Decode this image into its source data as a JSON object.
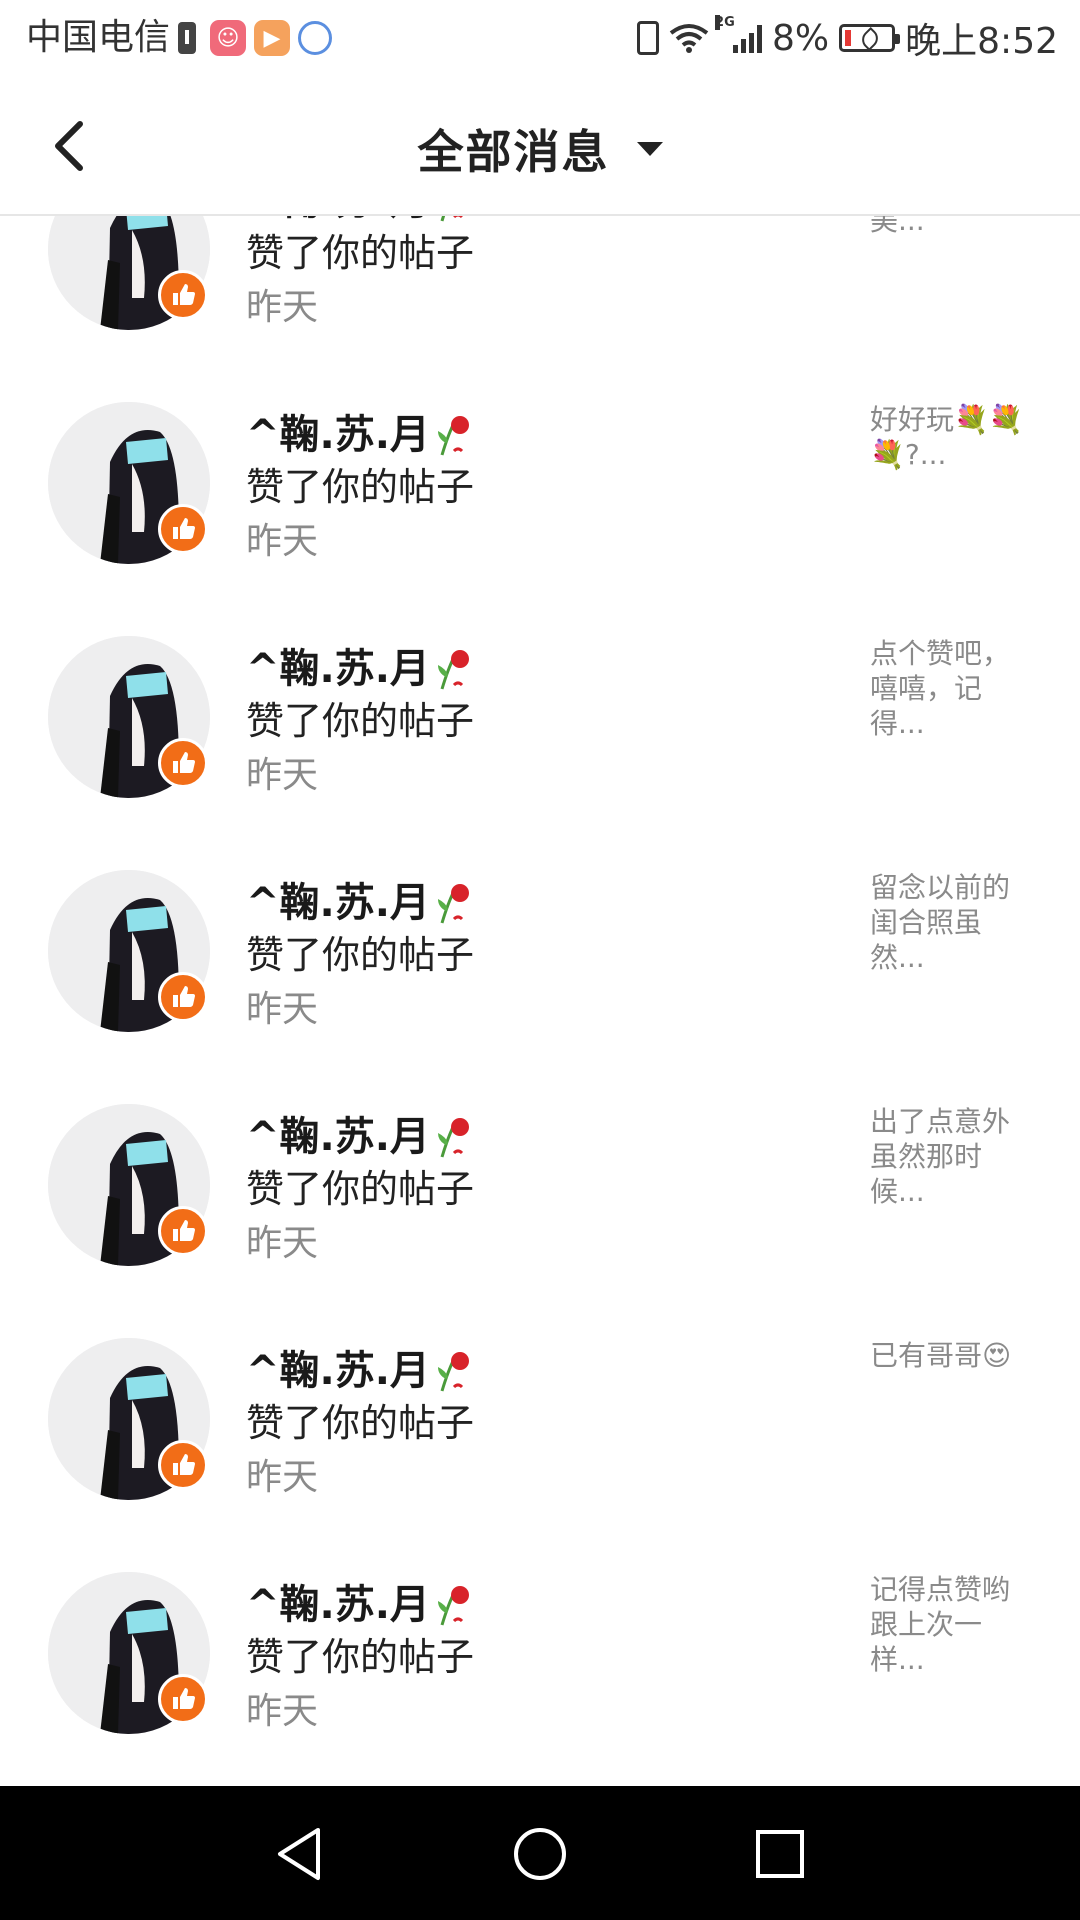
{
  "status_bar": {
    "carrier": "中国电信",
    "battery_percent": "8%",
    "time": "晚上8:52",
    "network": "2G"
  },
  "header": {
    "title": "全部消息"
  },
  "items": [
    {
      "name": "^鞠.苏.月",
      "action": "赞了你的帖子",
      "time": "昨天",
      "preview": "家闺也太美..."
    },
    {
      "name": "^鞠.苏.月",
      "action": "赞了你的帖子",
      "time": "昨天",
      "preview": "好好玩💐💐💐?..."
    },
    {
      "name": "^鞠.苏.月",
      "action": "赞了你的帖子",
      "time": "昨天",
      "preview": "点个赞吧，嘻嘻，记得..."
    },
    {
      "name": "^鞠.苏.月",
      "action": "赞了你的帖子",
      "time": "昨天",
      "preview": "留念以前的闺合照虽然..."
    },
    {
      "name": "^鞠.苏.月",
      "action": "赞了你的帖子",
      "time": "昨天",
      "preview": "出了点意外虽然那时候..."
    },
    {
      "name": "^鞠.苏.月",
      "action": "赞了你的帖子",
      "time": "昨天",
      "preview": "已有哥哥😍"
    },
    {
      "name": "^鞠.苏.月",
      "action": "赞了你的帖子",
      "time": "昨天",
      "preview": "记得点赞哟跟上次一样..."
    }
  ],
  "colors": {
    "badge": "#f26d17",
    "muted_text": "#8a8a8a",
    "navbar": "#000000"
  }
}
